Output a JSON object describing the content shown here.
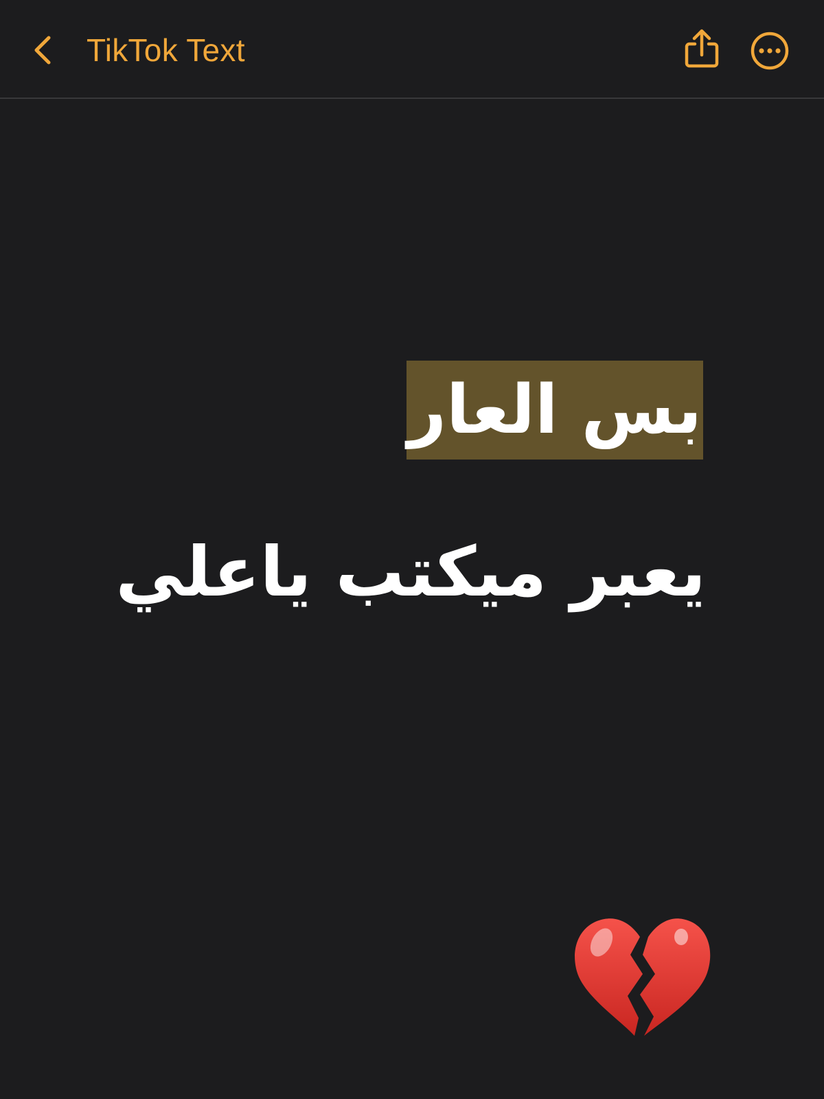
{
  "colors": {
    "background": "#1c1c1e",
    "accent": "#f0a73a",
    "highlight": "#63532b",
    "text": "#ffffff",
    "heart": "#e8362f"
  },
  "nav": {
    "back_icon": "chevron-left-icon",
    "title": "TikTok Text",
    "share_icon": "share-icon",
    "more_icon": "ellipsis-circle-icon"
  },
  "note": {
    "line1": "بس العار",
    "line2": "يعبر ميكتب ياعلي",
    "emoji": "💔",
    "emoji_icon": "broken-heart-icon"
  }
}
